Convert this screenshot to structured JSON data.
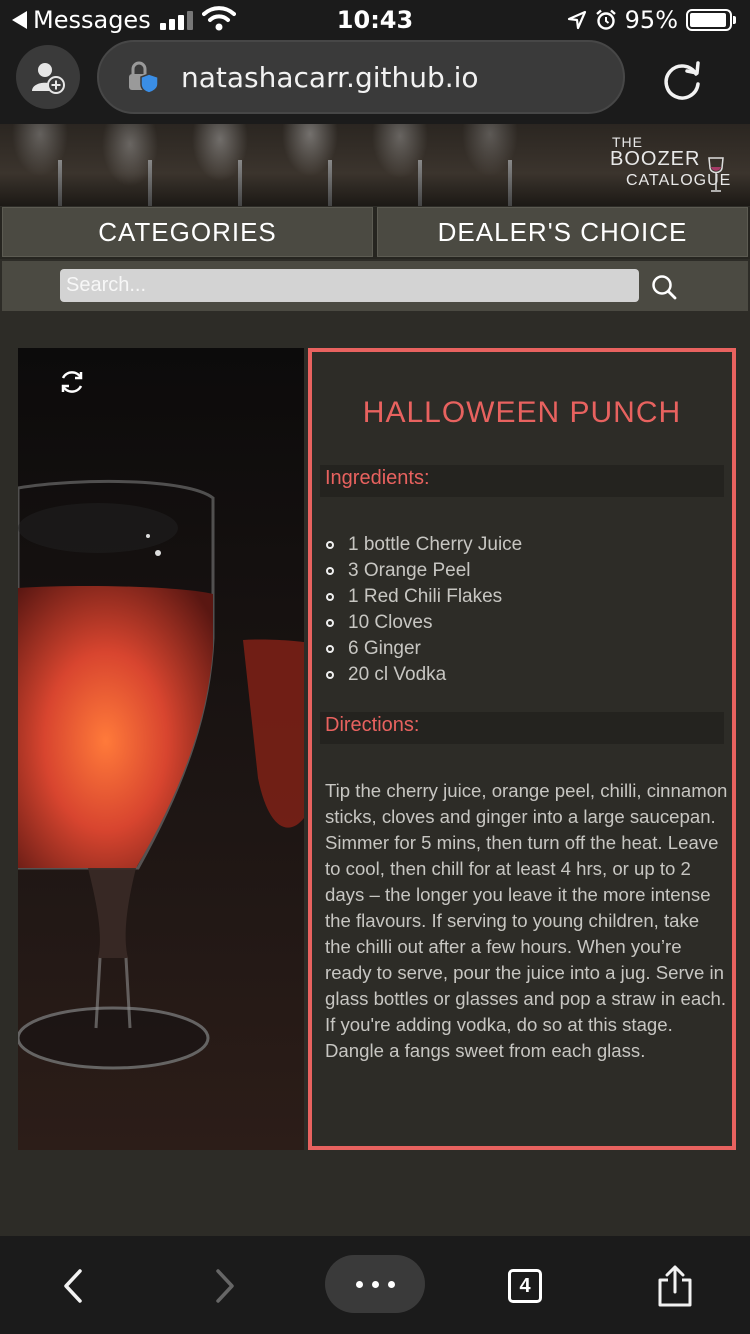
{
  "status_bar": {
    "back_app": "Messages",
    "time": "10:43",
    "battery": "95%",
    "battery_level": 0.95
  },
  "browser": {
    "url": "natashacarr.github.io",
    "tab_count": "4"
  },
  "site": {
    "brand": {
      "line1": "THE",
      "line2": "BOOZER",
      "line3": "CATALOGUE"
    },
    "nav": [
      {
        "label": "CATEGORIES"
      },
      {
        "label": "DEALER'S CHOICE"
      }
    ],
    "search": {
      "placeholder": "Search..."
    }
  },
  "recipe": {
    "title": "HALLOWEEN PUNCH",
    "ingredients_heading": "Ingredients:",
    "ingredients": [
      "1 bottle Cherry Juice",
      "3 Orange Peel",
      "1 Red Chili Flakes",
      "10 Cloves",
      "6 Ginger",
      "20 cl Vodka"
    ],
    "directions_heading": "Directions:",
    "directions": "Tip the cherry juice, orange peel, chilli, cinnamon sticks, cloves and ginger into a large saucepan. Simmer for 5 mins, then turn off the heat. Leave to cool, then chill for at least 4 hrs, or up to 2 days – the longer you leave it the more intense the flavours. If serving to young children, take the chilli out after a few hours.  When you’re ready to serve, pour the juice into a jug. Serve in glass bottles or glasses and pop a straw in each. If you're adding vodka, do so at this stage. Dangle a fangs sweet from each glass."
  },
  "colors": {
    "accent": "#e8625f",
    "page_bg": "#2d2c27",
    "nav_bg": "#4b4a42"
  },
  "icons": [
    "add-profile-icon",
    "privacy-lock-icon",
    "reload-icon",
    "search-icon",
    "flip-card-icon",
    "back-icon",
    "forward-icon",
    "more-icon",
    "tabs-icon",
    "share-icon"
  ]
}
